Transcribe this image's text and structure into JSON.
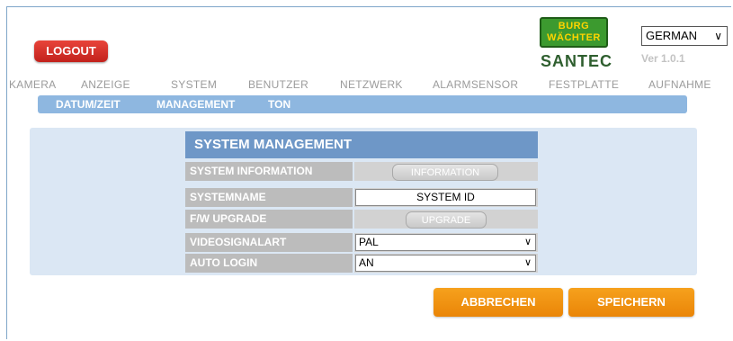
{
  "header": {
    "logout_label": "LOGOUT",
    "logo_line1": "BURG",
    "logo_line2": "WÄCHTER",
    "brand": "SANTEC",
    "language": "GERMAN",
    "version": "Ver 1.0.1"
  },
  "nav": {
    "items": [
      "KAMERA",
      "ANZEIGE",
      "SYSTEM",
      "BENUTZER",
      "NETZWERK",
      "ALARMSENSOR",
      "FESTPLATTE",
      "AUFNAHME"
    ]
  },
  "subnav": {
    "items": [
      "DATUM/ZEIT",
      "MANAGEMENT",
      "TON"
    ]
  },
  "panel": {
    "title": "SYSTEM MANAGEMENT",
    "rows": [
      {
        "label": "SYSTEM INFORMATION",
        "button": "INFORMATION"
      },
      {
        "label": "SYSTEMNAME",
        "value": "SYSTEM ID"
      },
      {
        "label": "F/W UPGRADE",
        "button": "UPGRADE"
      },
      {
        "label": "VIDEOSIGNALART",
        "selected": "PAL"
      },
      {
        "label": "AUTO LOGIN",
        "selected": "AN"
      }
    ]
  },
  "actions": {
    "cancel": "ABBRECHEN",
    "save": "SPEICHERN"
  },
  "colors": {
    "accent_blue": "#8eb7e0",
    "title_blue": "#6e97c7",
    "orange": "#f39a14",
    "logout_red": "#d42d25",
    "logo_green": "#3c9a2f",
    "logo_yellow": "#ffd400"
  },
  "icons": {
    "dropdown": "chevron-down-icon"
  }
}
